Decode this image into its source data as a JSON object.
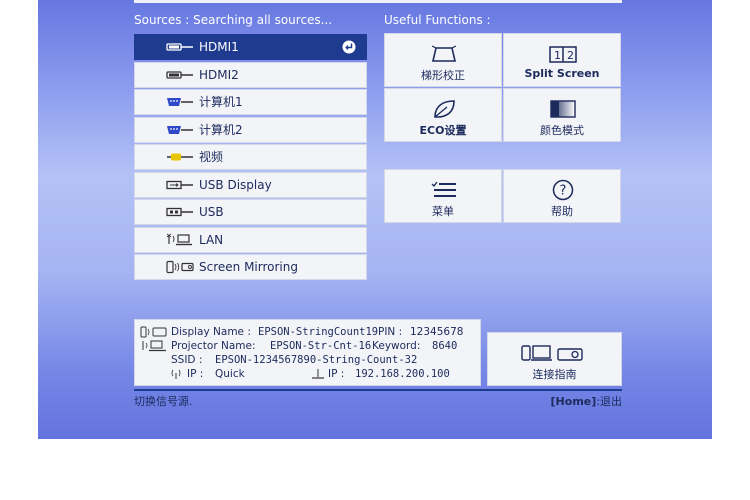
{
  "sources": {
    "title": "Sources :  Searching all sources...",
    "items": [
      {
        "label": "HDMI1",
        "icon": "hdmi-icon"
      },
      {
        "label": "HDMI2",
        "icon": "hdmi-icon"
      },
      {
        "label": "计算机1",
        "icon": "vga-icon"
      },
      {
        "label": "计算机2",
        "icon": "vga-icon"
      },
      {
        "label": "视频",
        "icon": "video-rca-icon"
      },
      {
        "label": "USB Display",
        "icon": "usb-display-icon"
      },
      {
        "label": "USB",
        "icon": "usb-icon"
      },
      {
        "label": "LAN",
        "icon": "lan-icon"
      },
      {
        "label": "Screen Mirroring",
        "icon": "screen-mirroring-icon"
      }
    ],
    "selected_index": 0
  },
  "useful_functions": {
    "title": "Useful Functions :",
    "tiles": [
      {
        "label": "梯形校正",
        "icon": "keystone-icon"
      },
      {
        "label": "Split Screen",
        "icon": "split-screen-icon"
      },
      {
        "label": "ECO设置",
        "icon": "eco-leaf-icon"
      },
      {
        "label": "颜色模式",
        "icon": "color-mode-icon"
      },
      {
        "label": "菜单",
        "icon": "menu-list-icon"
      },
      {
        "label": "帮助",
        "icon": "help-icon"
      }
    ]
  },
  "network_info": {
    "display_name_label": "Display Name :",
    "display_name_value": "EPSON-StringCount19",
    "pin_label": "PIN :",
    "pin_value": "12345678",
    "projector_name_label": "Projector Name:",
    "projector_name_value": "EPSON-Str-Cnt-16",
    "keyword_label": "Keyword:",
    "keyword_value": "8640",
    "ssid_label": "SSID :",
    "ssid_value": "EPSON-1234567890-String-Count-32",
    "wireless_ip_label": "IP :",
    "wireless_ip_value": "Quick",
    "wired_ip_label": "IP :",
    "wired_ip_value": "192.168.200.100"
  },
  "connection_guide": {
    "label": "连接指南",
    "icon": "connection-guide-icon"
  },
  "status_bar": {
    "left": "切换信号源.",
    "home_key": "[Home]",
    "home_action": ":退出"
  },
  "colors": {
    "accent": "#1f3b8f",
    "panel": "#f3f4f8",
    "text": "#1c2a5c"
  }
}
